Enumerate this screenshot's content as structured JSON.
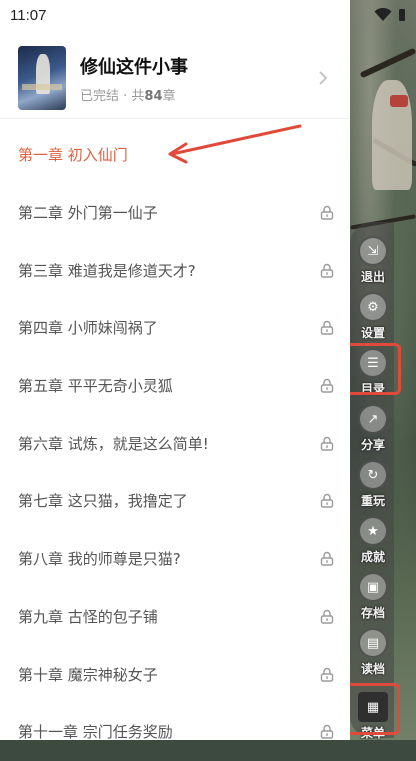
{
  "status": {
    "time": "11:07"
  },
  "book": {
    "title": "修仙这件小事",
    "status_text": "已完结",
    "sep": " · 共",
    "chapter_count": "84",
    "count_suffix": "章"
  },
  "chapters": [
    {
      "label": "第一章 初入仙门",
      "locked": false,
      "active": true
    },
    {
      "label": "第二章 外门第一仙子",
      "locked": true
    },
    {
      "label": "第三章 难道我是修道天才?",
      "locked": true
    },
    {
      "label": "第四章 小师妹闯祸了",
      "locked": true
    },
    {
      "label": "第五章 平平无奇小灵狐",
      "locked": true
    },
    {
      "label": "第六章  试炼，就是这么简单!",
      "locked": true
    },
    {
      "label": "第七章  这只猫，我撸定了",
      "locked": true
    },
    {
      "label": "第八章  我的师尊是只猫?",
      "locked": true
    },
    {
      "label": "第九章  古怪的包子铺",
      "locked": true
    },
    {
      "label": "第十章  魔宗神秘女子",
      "locked": true
    },
    {
      "label": "第十一章  宗门任务奖励",
      "locked": true
    }
  ],
  "side_menu": [
    {
      "label": "退出",
      "icon": "exit-icon"
    },
    {
      "label": "设置",
      "icon": "gear-icon"
    },
    {
      "label": "目录",
      "icon": "catalog-icon"
    },
    {
      "label": "分享",
      "icon": "share-icon"
    },
    {
      "label": "重玩",
      "icon": "replay-icon"
    },
    {
      "label": "成就",
      "icon": "achievement-icon"
    },
    {
      "label": "存档",
      "icon": "save-icon"
    },
    {
      "label": "读档",
      "icon": "load-icon"
    },
    {
      "label": "菜单",
      "icon": "menu-icon"
    }
  ],
  "colors": {
    "accent": "#e2603e",
    "annotation": "#e04a3a"
  }
}
